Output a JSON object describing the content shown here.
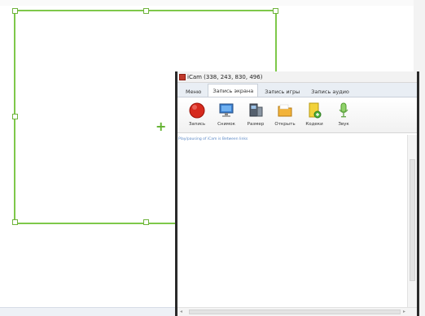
{
  "window": {
    "title": "iCam (338, 243, 830, 496)"
  },
  "tabs": [
    {
      "label": "Меню"
    },
    {
      "label": "Запись экрана",
      "active": true
    },
    {
      "label": "Запись игры"
    },
    {
      "label": "Запись аудио"
    }
  ],
  "toolbar": [
    {
      "label": "Запись",
      "icon": "record-icon"
    },
    {
      "label": "Снимок",
      "icon": "monitor-icon"
    },
    {
      "label": "Размер",
      "icon": "size-icon"
    },
    {
      "label": "Открыть",
      "icon": "folder-icon"
    },
    {
      "label": "Кодеки",
      "icon": "codecs-icon"
    },
    {
      "label": "Звук",
      "icon": "microphone-icon"
    }
  ],
  "content": {
    "hint": "Play/pausing of iCam is Between links"
  },
  "colors": {
    "selection_frame": "#7ec84a",
    "record_red": "#d62a1e",
    "window_border": "#2a2a2a"
  }
}
